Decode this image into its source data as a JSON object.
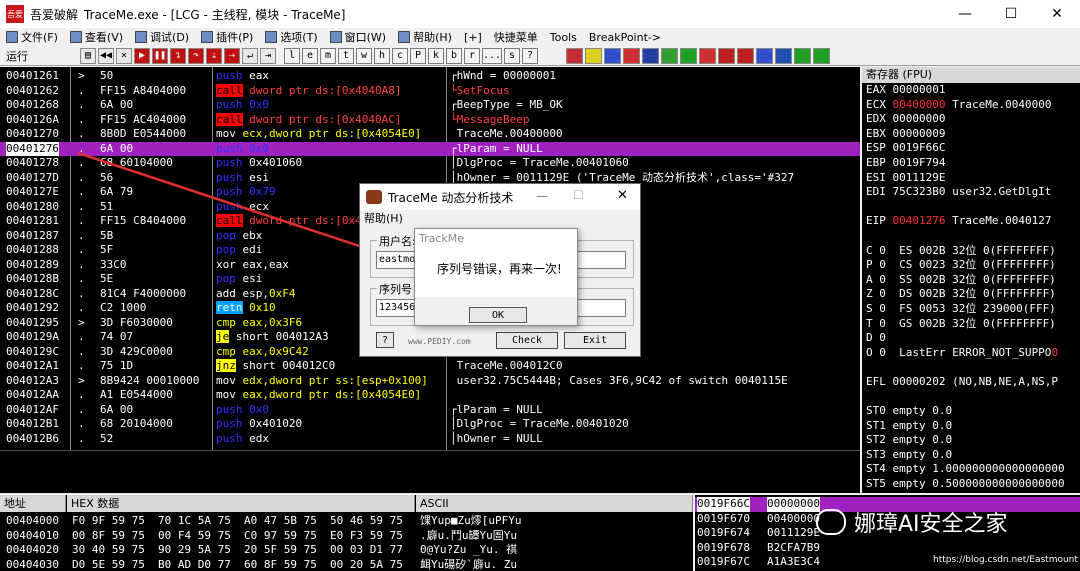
{
  "window": {
    "app_icon": "吾爱",
    "app_name": "吾爱破解",
    "title": "TraceMe.exe - [LCG - 主线程, 模块 - TraceMe]",
    "min": "—",
    "max": "☐",
    "close": "✕"
  },
  "menu": [
    "文件(F)",
    "查看(V)",
    "调试(D)",
    "插件(P)",
    "选项(T)",
    "窗口(W)",
    "帮助(H)",
    "[+]",
    "快捷菜单",
    "Tools",
    "BreakPoint->"
  ],
  "toolbar": {
    "status": "运行",
    "letters": [
      "l",
      "e",
      "m",
      "t",
      "w",
      "h",
      "c",
      "P",
      "k",
      "b",
      "r",
      "...",
      "s",
      "?"
    ]
  },
  "disasm": [
    {
      "addr": "00401261",
      "mk": ">",
      "hex": "50",
      "op": "push",
      "t": "push",
      "args": [
        [
          "eax",
          "w"
        ]
      ],
      "cmt": "┌hWnd = 00000001"
    },
    {
      "addr": "00401262",
      "mk": ".",
      "hex": "FF15 A8404000",
      "op": "call",
      "t": "call",
      "args": [
        [
          "dword ptr ds:[0x4040A8]",
          "r"
        ]
      ],
      "cmt": "└SetFocus",
      "cred": true
    },
    {
      "addr": "00401268",
      "mk": ".",
      "hex": "6A 00",
      "op": "push",
      "t": "push",
      "args": [
        [
          "0x0",
          "p"
        ]
      ],
      "cmt": "┌BeepType = MB_OK"
    },
    {
      "addr": "0040126A",
      "mk": ".",
      "hex": "FF15 AC404000",
      "op": "call",
      "t": "call",
      "args": [
        [
          "dword ptr ds:[0x4040AC]",
          "r"
        ]
      ],
      "cmt": "└MessageBeep",
      "cred": true
    },
    {
      "addr": "00401270",
      "mk": ".",
      "hex": "8B0D E0544000",
      "op": "mov",
      "t": "mov",
      "args": [
        [
          "ecx,dword ptr ds:[0x4054E0]",
          "y"
        ]
      ],
      "cmt": " TraceMe.00400000"
    },
    {
      "addr": "00401276",
      "mk": ".",
      "hex": "6A 00",
      "op": "push",
      "t": "push",
      "args": [
        [
          "0x0",
          "p"
        ]
      ],
      "cmt": "┌lParam = NULL",
      "hl": true
    },
    {
      "addr": "00401278",
      "mk": ".",
      "hex": "68 60104000",
      "op": "push",
      "t": "push",
      "args": [
        [
          "0x401060",
          "w"
        ]
      ],
      "cmt": "│DlgProc = TraceMe.00401060"
    },
    {
      "addr": "0040127D",
      "mk": ".",
      "hex": "56",
      "op": "push",
      "t": "push",
      "args": [
        [
          "esi",
          "w"
        ]
      ],
      "cmt": "│hOwner = 0011129E ('TraceMe 动态分析技术',class='#327"
    },
    {
      "addr": "0040127E",
      "mk": ".",
      "hex": "6A 79",
      "op": "push",
      "t": "push",
      "args": [
        [
          "0x79",
          "p"
        ]
      ],
      "cmt": ""
    },
    {
      "addr": "00401280",
      "mk": ".",
      "hex": "51",
      "op": "push",
      "t": "push",
      "args": [
        [
          "ecx",
          "w"
        ]
      ],
      "cmt": ""
    },
    {
      "addr": "00401281",
      "mk": ".",
      "hex": "FF15 C8404000",
      "op": "call",
      "t": "call",
      "args": [
        [
          "dword ptr ds:[0x4040C8]",
          "r"
        ]
      ],
      "cmt": ""
    },
    {
      "addr": "00401287",
      "mk": ".",
      "hex": "5B",
      "op": "pop",
      "t": "push",
      "args": [
        [
          "ebx",
          "w"
        ]
      ],
      "cmt": ""
    },
    {
      "addr": "00401288",
      "mk": ".",
      "hex": "5F",
      "op": "pop",
      "t": "push",
      "args": [
        [
          "edi",
          "w"
        ]
      ],
      "cmt": ""
    },
    {
      "addr": "00401289",
      "mk": ".",
      "hex": "33C0",
      "op": "xor",
      "t": "mov",
      "args": [
        [
          "eax,eax",
          "w"
        ]
      ],
      "cmt": ""
    },
    {
      "addr": "0040128B",
      "mk": ".",
      "hex": "5E",
      "op": "pop",
      "t": "push",
      "args": [
        [
          "esi",
          "w"
        ]
      ],
      "cmt": ""
    },
    {
      "addr": "0040128C",
      "mk": ".",
      "hex": "81C4 F4000000",
      "op": "add",
      "t": "mov",
      "args": [
        [
          "esp,",
          "w"
        ],
        [
          "0xF4",
          "y"
        ]
      ],
      "cmt": ""
    },
    {
      "addr": "00401292",
      "mk": ".",
      "hex": "C2 1000",
      "op": "retn",
      "t": "ret",
      "args": [
        [
          "0x10",
          "y"
        ]
      ],
      "cmt": ""
    },
    {
      "addr": "00401295",
      "mk": ">",
      "hex": "3D F6030000",
      "op": "cmp",
      "t": "cmp",
      "args": [
        [
          "eax,",
          "y"
        ],
        [
          "0x3F6",
          "y"
        ]
      ],
      "cmt": ""
    },
    {
      "addr": "0040129A",
      "mk": ".",
      "hex": "74 07",
      "op": "je",
      "t": "jcc",
      "args": [
        [
          "short 004012A3",
          "w"
        ]
      ],
      "cmt": ""
    },
    {
      "addr": "0040129C",
      "mk": ".",
      "hex": "3D 429C0000",
      "op": "cmp",
      "t": "cmp",
      "args": [
        [
          "eax,",
          "y"
        ],
        [
          "0x9C42",
          "y"
        ]
      ],
      "cmt": ""
    },
    {
      "addr": "004012A1",
      "mk": ".",
      "hex": "75 1D",
      "op": "jnz",
      "t": "jcc",
      "args": [
        [
          "short 004012C0",
          "w"
        ]
      ],
      "cmt": " TraceMe.004012C0"
    },
    {
      "addr": "004012A3",
      "mk": ">",
      "hex": "8B9424 00010000",
      "op": "mov",
      "t": "mov",
      "args": [
        [
          "edx,dword ptr ss:[esp+0x100]",
          "y"
        ]
      ],
      "cmt": " user32.75C5444B; Cases 3F6,9C42 of switch 0040115E"
    },
    {
      "addr": "004012AA",
      "mk": ".",
      "hex": "A1 E0544000",
      "op": "mov",
      "t": "mov",
      "args": [
        [
          "eax,dword ptr ds:[0x4054E0]",
          "y"
        ]
      ],
      "cmt": ""
    },
    {
      "addr": "004012AF",
      "mk": ".",
      "hex": "6A 00",
      "op": "push",
      "t": "push",
      "args": [
        [
          "0x0",
          "p"
        ]
      ],
      "cmt": "┌lParam = NULL"
    },
    {
      "addr": "004012B1",
      "mk": ".",
      "hex": "68 20104000",
      "op": "push",
      "t": "push",
      "args": [
        [
          "0x401020",
          "w"
        ]
      ],
      "cmt": "│DlgProc = TraceMe.00401020"
    },
    {
      "addr": "004012B6",
      "mk": ".",
      "hex": "52",
      "op": "push",
      "t": "push",
      "args": [
        [
          "edx",
          "w"
        ]
      ],
      "cmt": "│hOwner = NULL"
    }
  ],
  "regs": {
    "header": "寄存器 (FPU)",
    "rows": [
      {
        "t": "EAX 00000001"
      },
      {
        "t": "ECX ",
        "red": "00400000",
        "rest": " TraceMe.0040000"
      },
      {
        "t": "EDX 00000000"
      },
      {
        "t": "EBX 00000009"
      },
      {
        "t": "ESP 0019F66C"
      },
      {
        "t": "EBP 0019F794"
      },
      {
        "t": "ESI 0011129E"
      },
      {
        "t": "EDI 75C323B0 user32.GetDlgIt"
      },
      {
        "t": ""
      },
      {
        "t": "EIP ",
        "red": "00401276",
        "rest": " TraceMe.0040127"
      },
      {
        "t": ""
      },
      {
        "t": "C 0  ES 002B 32位 0(FFFFFFFF)"
      },
      {
        "t": "P 0  CS 0023 32位 0(FFFFFFFF)"
      },
      {
        "t": "A 0  SS 002B 32位 0(FFFFFFFF)"
      },
      {
        "t": "Z 0  DS 002B 32位 0(FFFFFFFF)"
      },
      {
        "t": "S 0  FS 0053 32位 239000(FFF)"
      },
      {
        "t": "T 0  GS 002B 32位 0(FFFFFFFF)"
      },
      {
        "t": "D 0"
      },
      {
        "t": "O 0  LastErr ERROR_NOT_SUPPO",
        "tail": "0"
      },
      {
        "t": ""
      },
      {
        "t": "EFL 00000202 (NO,NB,NE,A,NS,P"
      },
      {
        "t": ""
      },
      {
        "t": "ST0 empty 0.0"
      },
      {
        "t": "ST1 empty 0.0"
      },
      {
        "t": "ST2 empty 0.0"
      },
      {
        "t": "ST3 empty 0.0"
      },
      {
        "t": "ST4 empty 1.000000000000000000"
      },
      {
        "t": "ST5 empty 0.500000000000000000"
      },
      {
        "t": "ST6 empty 1.000000000000000000"
      },
      {
        "t": "ST7 empty 1.000000000000000000"
      }
    ]
  },
  "dump": {
    "head_addr": "地址",
    "head_hex": "HEX 数据",
    "head_ascii": "ASCII",
    "rows": [
      {
        "addr": "00404000",
        "h1": "F0 9F 59 75",
        "h2": "70 1C 5A 75",
        "h3": "A0 47 5B 75",
        "h4": "50 46 59 75",
        "asc": "馃Yup■Zu燯[uPFYu"
      },
      {
        "addr": "00404010",
        "h1": "00 8F 59 75",
        "h2": "00 F4 59 75",
        "h3": "C0 97 59 75",
        "h4": "E0 F3 59 75",
        "asc": ".廦u.鬥u罈Yu圄Yu"
      },
      {
        "addr": "00404020",
        "h1": "30 40 59 75",
        "h2": "90 29 5A 75",
        "h3": "20 5F 59 75",
        "h4": "00 03 D1 77",
        "asc": "0@Yu?Zu _Yu. 祺"
      },
      {
        "addr": "00404030",
        "h1": "D0 5E 59 75",
        "h2": "B0 AD D0 77",
        "h3": "60 8F 59 75",
        "h4": "00 20 5A 75",
        "asc": "衈Yu碭矽`廦u. Zu"
      }
    ]
  },
  "stack": [
    {
      "addr": "0019F66C",
      "val": "00000000",
      "hl": true
    },
    {
      "addr": "0019F670",
      "val": "00400000"
    },
    {
      "addr": "0019F674",
      "val": "0011129E"
    },
    {
      "addr": "0019F678",
      "val": "B2CFA7B9"
    },
    {
      "addr": "0019F67C",
      "val": "A1A3E3C4"
    }
  ],
  "dialog": {
    "title": "TraceMe 动态分析技术",
    "min": "—",
    "max": "☐",
    "close": "✕",
    "menu": "帮助(H)",
    "user_label": "用户名:",
    "user_value": "eastmou",
    "serial_label": "序列号",
    "serial_value": "123456",
    "help_btn": "?",
    "url": "www.PEDIY.com",
    "check_btn": "Check",
    "exit_btn": "Exit"
  },
  "msgbox": {
    "title": "TrackMe",
    "text": "序列号错误，再来一次!",
    "ok": "OK"
  },
  "watermark": {
    "name": "娜璋AI安全之家",
    "url": "https://blog.csdn.net/Eastmount"
  },
  "colors": {
    "highlight": "#a020c0",
    "call": "#ff0000",
    "push": "#3030ff",
    "arrow": "#e03030"
  }
}
